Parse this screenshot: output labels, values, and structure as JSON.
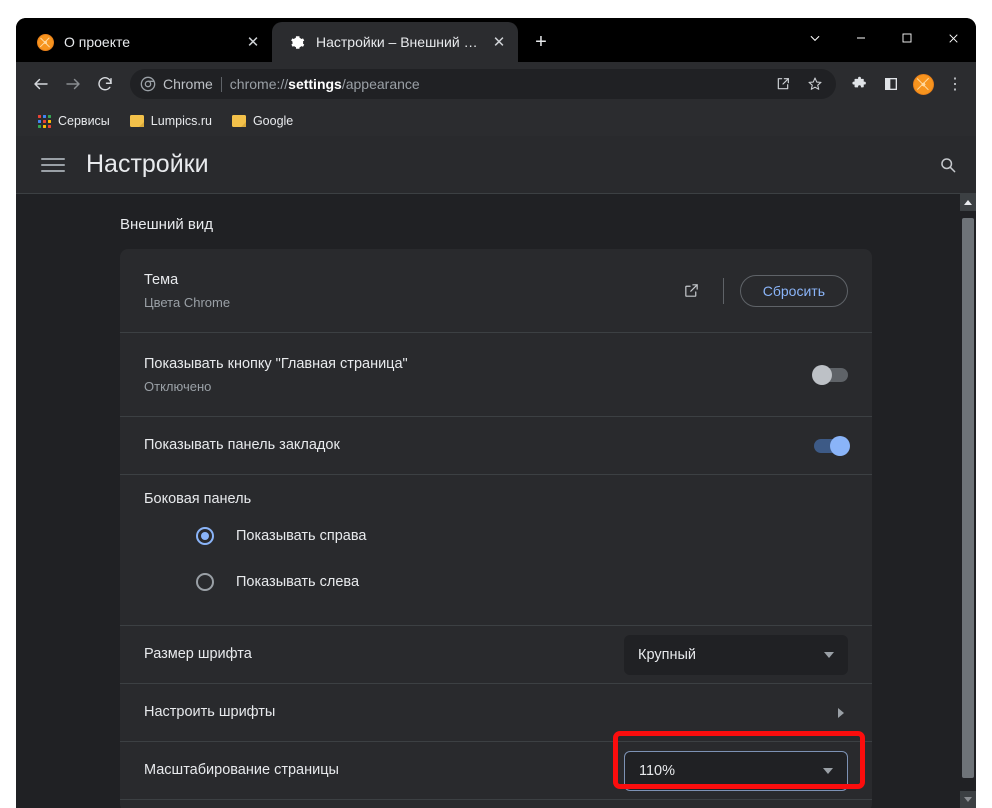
{
  "window": {
    "controls": {
      "tab_search": "chevron-down",
      "minimize": "–",
      "maximize": "□",
      "close": "✕"
    }
  },
  "tabs": [
    {
      "title": "О проекте",
      "favicon": "citrus-icon",
      "active": false,
      "close": "✕"
    },
    {
      "title": "Настройки – Внешний вид",
      "favicon": "gear-icon",
      "active": true,
      "close": "✕"
    }
  ],
  "newtab_label": "+",
  "toolbar": {
    "back": "←",
    "forward": "→",
    "reload": "⟳",
    "omnibox": {
      "chip_label": "Chrome",
      "url_prefix": "chrome://",
      "url_bold": "settings",
      "url_suffix": "/appearance"
    },
    "share": "share-icon",
    "bookmark": "star-icon",
    "extensions": "puzzle-icon",
    "side_panel": "side-panel-icon",
    "profile": "avatar",
    "menu": "⋮"
  },
  "bookmarks": [
    {
      "label": "Сервисы",
      "icon": "apps-grid-icon"
    },
    {
      "label": "Lumpics.ru",
      "icon": "folder-icon"
    },
    {
      "label": "Google",
      "icon": "folder-icon"
    }
  ],
  "settings": {
    "title": "Настройки",
    "menu_icon": "hamburger-icon",
    "search_icon": "search-icon",
    "section_title": "Внешний вид",
    "rows": {
      "theme": {
        "label": "Тема",
        "sublabel": "Цвета Chrome",
        "open_icon": "external-link-icon",
        "reset_label": "Сбросить"
      },
      "home_button": {
        "label": "Показывать кнопку \"Главная страница\"",
        "sublabel": "Отключено",
        "toggle_state": "off"
      },
      "bookmarks_bar": {
        "label": "Показывать панель закладок",
        "toggle_state": "on"
      },
      "side_panel": {
        "label": "Боковая панель",
        "options": [
          {
            "label": "Показывать справа",
            "selected": true
          },
          {
            "label": "Показывать слева",
            "selected": false
          }
        ]
      },
      "font_size": {
        "label": "Размер шрифта",
        "value": "Крупный"
      },
      "customize_fonts": {
        "label": "Настроить шрифты",
        "arrow": "chevron-right-icon"
      },
      "page_zoom": {
        "label": "Масштабирование страницы",
        "value": "110%",
        "highlighted": true
      }
    }
  },
  "colors": {
    "accent_blue": "#8ab4f8",
    "toggle_on": "#3d5a86",
    "annotation_red": "#fb0d0d",
    "page_bg": "#202124",
    "card_bg": "#292a2d",
    "toolbar_bg": "#2b2c2f"
  }
}
